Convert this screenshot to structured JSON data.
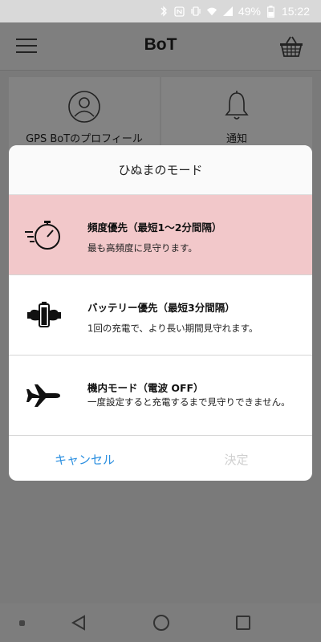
{
  "status_bar": {
    "battery_percent": "49%",
    "time": "15:22"
  },
  "header": {
    "title": "BoT"
  },
  "background_cards": [
    {
      "label": "GPS BoTのプロフィール"
    },
    {
      "label": "通知"
    }
  ],
  "dialog": {
    "title": "ひぬまのモード",
    "options": [
      {
        "title": "頻度優先（最短1〜2分間隔）",
        "description": "最も高頻度に見守ります。",
        "selected": true
      },
      {
        "title": "バッテリー優先（最短3分間隔）",
        "description": "1回の充電で、より長い期間見守れます。",
        "selected": false
      },
      {
        "title": "機内モード（電波 OFF）",
        "description": "一度設定すると充電するまで見守りできません。",
        "selected": false
      }
    ],
    "cancel_label": "キャンセル",
    "confirm_label": "決定"
  },
  "colors": {
    "selected_bg": "#f2c8ca",
    "accent": "#2b8fe0",
    "disabled": "#cfcfcf"
  }
}
